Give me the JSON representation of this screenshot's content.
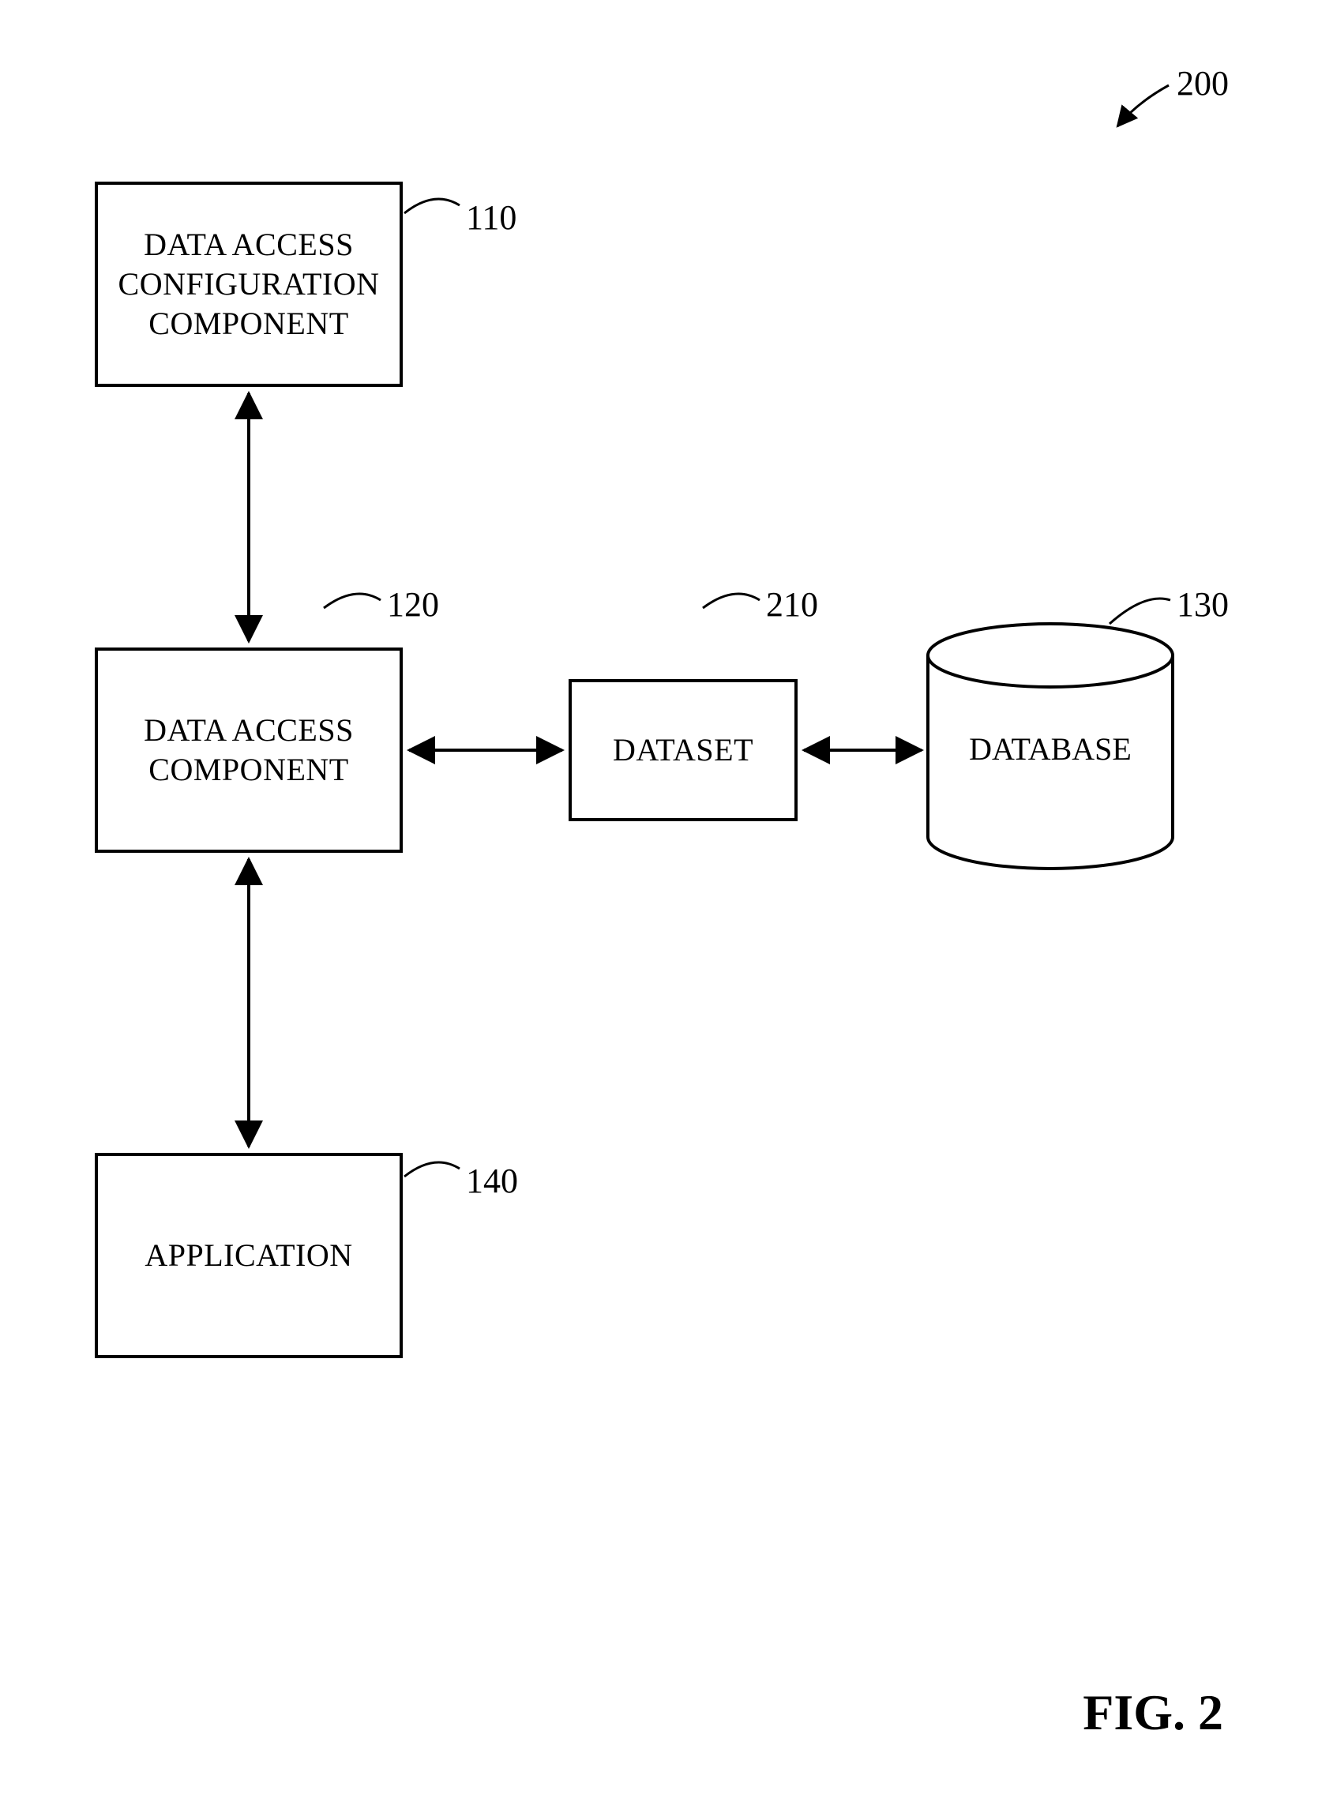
{
  "figure_ref": "200",
  "figure_caption": "FIG. 2",
  "blocks": {
    "config": {
      "ref": "110",
      "label": "DATA ACCESS\nCONFIGURATION\nCOMPONENT"
    },
    "access": {
      "ref": "120",
      "label": "DATA ACCESS\nCOMPONENT"
    },
    "dataset": {
      "ref": "210",
      "label": "DATASET"
    },
    "database": {
      "ref": "130",
      "label": "DATABASE"
    },
    "app": {
      "ref": "140",
      "label": "APPLICATION"
    }
  }
}
